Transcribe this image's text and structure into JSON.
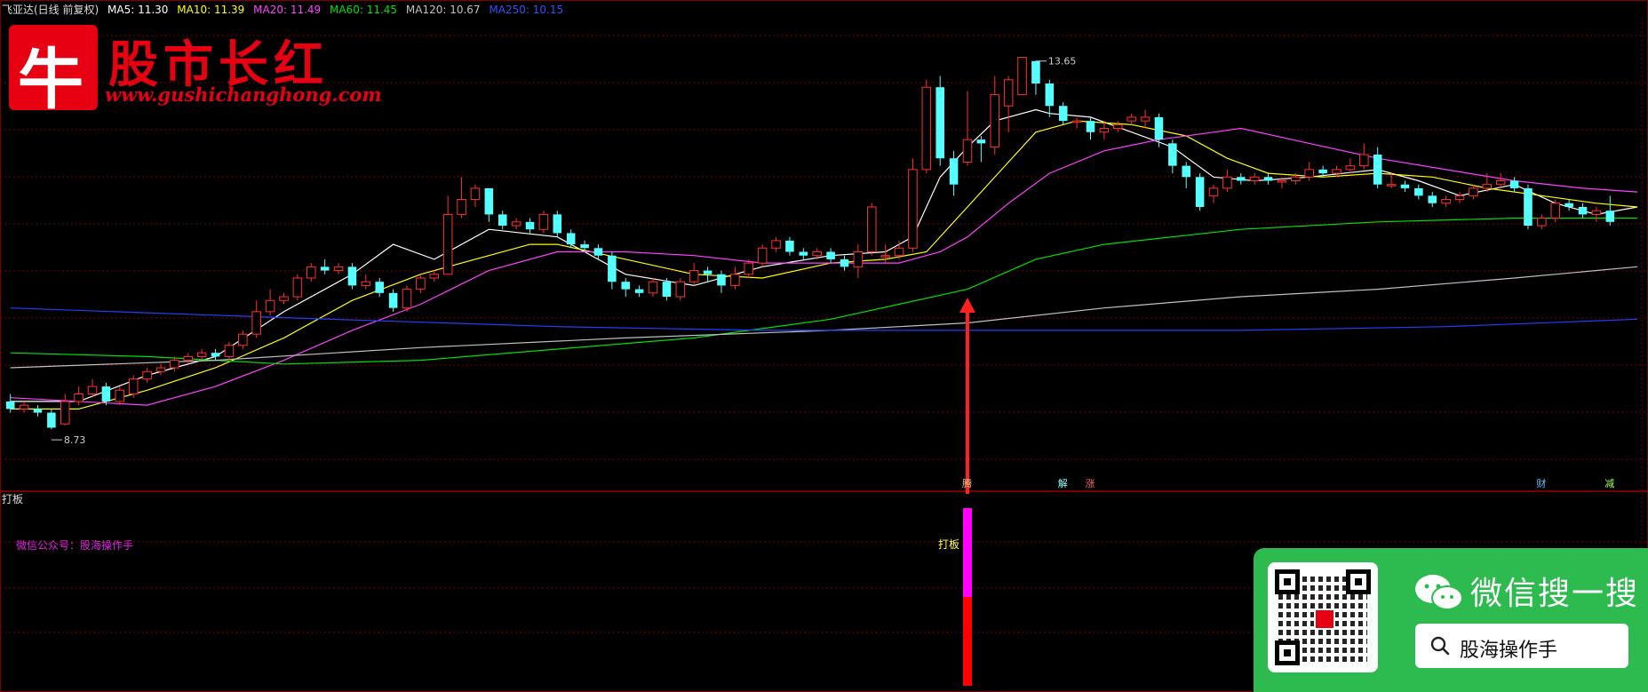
{
  "header": {
    "stock": "飞亚达(日线 前复权)",
    "ma5": "MA5: 11.30",
    "ma10": "MA10: 11.39",
    "ma20": "MA20: 11.49",
    "ma60": "MA60: 11.45",
    "ma120": "MA120: 10.67",
    "ma250": "MA250: 10.15"
  },
  "logo": {
    "glyph": "牛",
    "title": "股市长红",
    "url": "www.gushichanghong.com"
  },
  "sub_panel": {
    "title": "打板",
    "wechat_note": "微信公众号：股海操作手",
    "signal_label": "打板"
  },
  "wechat_card": {
    "title": "微信搜一搜",
    "search_text": "股海操作手"
  },
  "colors": {
    "up": "#ff3030",
    "down": "#54ffff",
    "ma5": "#ffffff",
    "ma10": "#ffff00",
    "ma20": "#ff40ff",
    "ma60": "#00e000",
    "ma120": "#c0c0c0",
    "ma250": "#2040ff",
    "grid": "#7a0000"
  },
  "chart_data": {
    "type": "candlestick",
    "y_range": [
      7.9,
      14.3
    ],
    "high_label": "13.65",
    "low_label": "8.73",
    "markers": [
      "腾",
      "解",
      "涨",
      "财",
      "减"
    ],
    "candles": [
      [
        9.1,
        9.0,
        9.2,
        8.95
      ],
      [
        9.0,
        9.05,
        9.1,
        8.95
      ],
      [
        9.0,
        8.95,
        9.05,
        8.9
      ],
      [
        8.95,
        8.75,
        9.0,
        8.73
      ],
      [
        8.8,
        9.1,
        9.2,
        8.78
      ],
      [
        9.1,
        9.2,
        9.3,
        9.05
      ],
      [
        9.2,
        9.3,
        9.4,
        9.15
      ],
      [
        9.3,
        9.1,
        9.35,
        9.05
      ],
      [
        9.1,
        9.25,
        9.3,
        9.05
      ],
      [
        9.2,
        9.4,
        9.45,
        9.15
      ],
      [
        9.4,
        9.5,
        9.55,
        9.35
      ],
      [
        9.5,
        9.55,
        9.6,
        9.45
      ],
      [
        9.55,
        9.65,
        9.7,
        9.5
      ],
      [
        9.65,
        9.7,
        9.75,
        9.6
      ],
      [
        9.7,
        9.75,
        9.8,
        9.65
      ],
      [
        9.75,
        9.7,
        9.8,
        9.65
      ],
      [
        9.7,
        9.85,
        9.9,
        9.65
      ],
      [
        9.85,
        10.0,
        10.05,
        9.8
      ],
      [
        10.0,
        10.3,
        10.45,
        9.95
      ],
      [
        10.3,
        10.45,
        10.6,
        10.25
      ],
      [
        10.45,
        10.5,
        10.55,
        10.4
      ],
      [
        10.5,
        10.75,
        10.8,
        10.45
      ],
      [
        10.75,
        10.9,
        10.95,
        10.7
      ],
      [
        10.9,
        10.85,
        11.0,
        10.8
      ],
      [
        10.85,
        10.9,
        10.95,
        10.8
      ],
      [
        10.9,
        10.65,
        10.95,
        10.6
      ],
      [
        10.65,
        10.7,
        10.8,
        10.6
      ],
      [
        10.7,
        10.55,
        10.75,
        10.5
      ],
      [
        10.55,
        10.35,
        10.6,
        10.3
      ],
      [
        10.35,
        10.6,
        10.65,
        10.3
      ],
      [
        10.6,
        10.75,
        10.8,
        10.55
      ],
      [
        10.75,
        10.8,
        10.85,
        10.7
      ],
      [
        10.8,
        11.6,
        11.85,
        10.8
      ],
      [
        11.6,
        11.8,
        12.1,
        11.55
      ],
      [
        11.8,
        11.95,
        12.0,
        11.7
      ],
      [
        11.95,
        11.6,
        11.95,
        11.5
      ],
      [
        11.6,
        11.45,
        11.65,
        11.4
      ],
      [
        11.45,
        11.5,
        11.55,
        11.4
      ],
      [
        11.5,
        11.4,
        11.55,
        11.35
      ],
      [
        11.4,
        11.6,
        11.65,
        11.35
      ],
      [
        11.6,
        11.35,
        11.65,
        11.3
      ],
      [
        11.35,
        11.2,
        11.4,
        11.15
      ],
      [
        11.2,
        11.15,
        11.25,
        11.1
      ],
      [
        11.15,
        11.05,
        11.2,
        11.0
      ],
      [
        11.05,
        10.7,
        11.1,
        10.6
      ],
      [
        10.7,
        10.6,
        10.75,
        10.5
      ],
      [
        10.6,
        10.55,
        10.65,
        10.5
      ],
      [
        10.55,
        10.7,
        10.75,
        10.5
      ],
      [
        10.7,
        10.5,
        10.75,
        10.45
      ],
      [
        10.5,
        10.7,
        10.75,
        10.45
      ],
      [
        10.7,
        10.85,
        10.95,
        10.65
      ],
      [
        10.85,
        10.8,
        10.9,
        10.7
      ],
      [
        10.8,
        10.65,
        10.85,
        10.55
      ],
      [
        10.65,
        10.8,
        10.9,
        10.6
      ],
      [
        10.8,
        10.95,
        11.0,
        10.75
      ],
      [
        10.95,
        11.15,
        11.2,
        10.9
      ],
      [
        11.15,
        11.25,
        11.3,
        11.1
      ],
      [
        11.25,
        11.1,
        11.3,
        11.05
      ],
      [
        11.1,
        11.05,
        11.15,
        11.0
      ],
      [
        11.05,
        11.1,
        11.15,
        11.0
      ],
      [
        11.1,
        11.0,
        11.15,
        10.95
      ],
      [
        11.0,
        10.9,
        11.05,
        10.85
      ],
      [
        10.9,
        11.1,
        11.2,
        10.75
      ],
      [
        11.1,
        11.7,
        11.75,
        11.05
      ],
      [
        11.05,
        11.05,
        11.2,
        10.95
      ],
      [
        11.05,
        11.15,
        11.25,
        11.0
      ],
      [
        11.15,
        12.2,
        12.35,
        11.1
      ],
      [
        12.2,
        13.3,
        13.4,
        12.15
      ],
      [
        13.3,
        12.35,
        13.45,
        12.25
      ],
      [
        12.35,
        12.0,
        12.45,
        11.85
      ],
      [
        12.3,
        12.6,
        13.25,
        12.25
      ],
      [
        12.6,
        12.55,
        12.65,
        12.3
      ],
      [
        12.5,
        13.2,
        13.45,
        12.4
      ],
      [
        13.05,
        13.4,
        13.45,
        12.7
      ],
      [
        13.2,
        13.7,
        13.5,
        13.3
      ],
      [
        13.65,
        13.35,
        13.65,
        13.2
      ],
      [
        13.35,
        13.05,
        13.4,
        12.9
      ],
      [
        13.05,
        12.85,
        13.1,
        12.8
      ],
      [
        12.85,
        12.85,
        12.9,
        12.75
      ],
      [
        12.85,
        12.7,
        12.9,
        12.6
      ],
      [
        12.7,
        12.75,
        12.85,
        12.6
      ],
      [
        12.75,
        12.8,
        12.85,
        12.7
      ],
      [
        12.85,
        12.9,
        12.95,
        12.8
      ],
      [
        12.85,
        12.9,
        13.0,
        12.75
      ],
      [
        12.9,
        12.6,
        12.95,
        12.5
      ],
      [
        12.55,
        12.25,
        12.6,
        12.15
      ],
      [
        12.25,
        12.1,
        12.3,
        11.95
      ],
      [
        12.1,
        11.7,
        12.15,
        11.65
      ],
      [
        11.85,
        11.95,
        12.0,
        11.75
      ],
      [
        11.95,
        12.1,
        12.2,
        11.9
      ],
      [
        12.1,
        12.05,
        12.15,
        12.0
      ],
      [
        12.05,
        12.1,
        12.15,
        12.0
      ],
      [
        12.1,
        12.05,
        12.15,
        12.0
      ],
      [
        12.05,
        12.05,
        12.1,
        11.95
      ],
      [
        12.05,
        12.1,
        12.15,
        12.0
      ],
      [
        12.1,
        12.2,
        12.3,
        12.05
      ],
      [
        12.2,
        12.15,
        12.25,
        12.1
      ],
      [
        12.15,
        12.2,
        12.25,
        12.1
      ],
      [
        12.2,
        12.25,
        12.35,
        12.15
      ],
      [
        12.25,
        12.4,
        12.55,
        12.2
      ],
      [
        12.4,
        12.0,
        12.5,
        11.95
      ],
      [
        12.0,
        12.0,
        12.15,
        11.95
      ],
      [
        12.0,
        11.95,
        12.05,
        11.9
      ],
      [
        11.95,
        11.85,
        12.0,
        11.8
      ],
      [
        11.85,
        11.75,
        11.9,
        11.7
      ],
      [
        11.75,
        11.8,
        11.85,
        11.7
      ],
      [
        11.8,
        11.85,
        11.9,
        11.75
      ],
      [
        11.85,
        11.95,
        12.0,
        11.8
      ],
      [
        11.95,
        12.0,
        12.15,
        11.9
      ],
      [
        12.0,
        12.05,
        12.15,
        11.95
      ],
      [
        12.05,
        11.95,
        12.1,
        11.9
      ],
      [
        11.95,
        11.45,
        12.0,
        11.4
      ],
      [
        11.45,
        11.55,
        11.6,
        11.4
      ],
      [
        11.55,
        11.75,
        11.8,
        11.5
      ],
      [
        11.75,
        11.7,
        11.8,
        11.65
      ],
      [
        11.7,
        11.6,
        11.75,
        11.55
      ],
      [
        11.6,
        11.65,
        11.7,
        11.5
      ],
      [
        11.65,
        11.5,
        11.85,
        11.45
      ]
    ],
    "ma": {
      "ma5": [
        [
          0,
          9.1
        ],
        [
          5,
          9.1
        ],
        [
          10,
          9.45
        ],
        [
          15,
          9.7
        ],
        [
          20,
          10.3
        ],
        [
          25,
          10.8
        ],
        [
          28,
          11.2
        ],
        [
          31,
          11.0
        ],
        [
          35,
          11.4
        ],
        [
          40,
          11.3
        ],
        [
          45,
          10.8
        ],
        [
          50,
          10.65
        ],
        [
          55,
          10.9
        ],
        [
          60,
          11.05
        ],
        [
          64,
          11.1
        ],
        [
          66,
          11.3
        ],
        [
          68,
          12.1
        ],
        [
          70,
          12.5
        ],
        [
          72,
          12.85
        ],
        [
          75,
          13.0
        ],
        [
          76,
          12.95
        ],
        [
          79,
          12.9
        ],
        [
          85,
          12.5
        ],
        [
          88,
          12.1
        ],
        [
          91,
          12.05
        ],
        [
          95,
          12.1
        ],
        [
          100,
          12.2
        ],
        [
          103,
          12.05
        ],
        [
          106,
          11.85
        ],
        [
          110,
          12.0
        ],
        [
          113,
          11.75
        ],
        [
          116,
          11.6
        ],
        [
          119,
          11.7
        ]
      ],
      "ma10": [
        [
          0,
          9.0
        ],
        [
          5,
          9.0
        ],
        [
          10,
          9.25
        ],
        [
          15,
          9.55
        ],
        [
          20,
          9.95
        ],
        [
          25,
          10.45
        ],
        [
          30,
          10.8
        ],
        [
          35,
          11.05
        ],
        [
          38,
          11.2
        ],
        [
          40,
          11.2
        ],
        [
          45,
          11.0
        ],
        [
          50,
          10.8
        ],
        [
          55,
          10.75
        ],
        [
          60,
          10.95
        ],
        [
          64,
          11.0
        ],
        [
          67,
          11.1
        ],
        [
          70,
          11.7
        ],
        [
          73,
          12.3
        ],
        [
          75,
          12.7
        ],
        [
          78,
          12.85
        ],
        [
          82,
          12.8
        ],
        [
          86,
          12.65
        ],
        [
          89,
          12.35
        ],
        [
          92,
          12.15
        ],
        [
          96,
          12.1
        ],
        [
          100,
          12.15
        ],
        [
          104,
          12.1
        ],
        [
          108,
          11.95
        ],
        [
          112,
          11.85
        ],
        [
          116,
          11.75
        ],
        [
          119,
          11.7
        ]
      ],
      "ma20": [
        [
          0,
          9.15
        ],
        [
          10,
          9.05
        ],
        [
          15,
          9.3
        ],
        [
          20,
          9.65
        ],
        [
          25,
          10.05
        ],
        [
          30,
          10.4
        ],
        [
          35,
          10.85
        ],
        [
          40,
          11.1
        ],
        [
          45,
          11.1
        ],
        [
          50,
          11.05
        ],
        [
          55,
          10.95
        ],
        [
          60,
          10.95
        ],
        [
          65,
          10.95
        ],
        [
          68,
          11.1
        ],
        [
          70,
          11.3
        ],
        [
          73,
          11.75
        ],
        [
          76,
          12.15
        ],
        [
          80,
          12.45
        ],
        [
          84,
          12.6
        ],
        [
          88,
          12.7
        ],
        [
          90,
          12.75
        ],
        [
          95,
          12.55
        ],
        [
          100,
          12.35
        ],
        [
          105,
          12.2
        ],
        [
          110,
          12.05
        ],
        [
          115,
          11.95
        ],
        [
          119,
          11.9
        ]
      ],
      "ma60": [
        [
          0,
          9.75
        ],
        [
          10,
          9.7
        ],
        [
          20,
          9.6
        ],
        [
          30,
          9.65
        ],
        [
          40,
          9.8
        ],
        [
          50,
          9.95
        ],
        [
          60,
          10.2
        ],
        [
          70,
          10.6
        ],
        [
          75,
          11.0
        ],
        [
          80,
          11.2
        ],
        [
          90,
          11.4
        ],
        [
          100,
          11.5
        ],
        [
          110,
          11.55
        ],
        [
          119,
          11.55
        ]
      ],
      "ma120": [
        [
          0,
          9.55
        ],
        [
          15,
          9.65
        ],
        [
          30,
          9.82
        ],
        [
          45,
          9.95
        ],
        [
          60,
          10.05
        ],
        [
          70,
          10.15
        ],
        [
          80,
          10.35
        ],
        [
          90,
          10.5
        ],
        [
          100,
          10.6
        ],
        [
          110,
          10.75
        ],
        [
          119,
          10.9
        ]
      ],
      "ma250": [
        [
          0,
          10.35
        ],
        [
          20,
          10.22
        ],
        [
          40,
          10.1
        ],
        [
          55,
          10.05
        ],
        [
          65,
          10.05
        ],
        [
          75,
          10.05
        ],
        [
          90,
          10.05
        ],
        [
          105,
          10.1
        ],
        [
          119,
          10.2
        ]
      ]
    },
    "signal_index": 70
  }
}
